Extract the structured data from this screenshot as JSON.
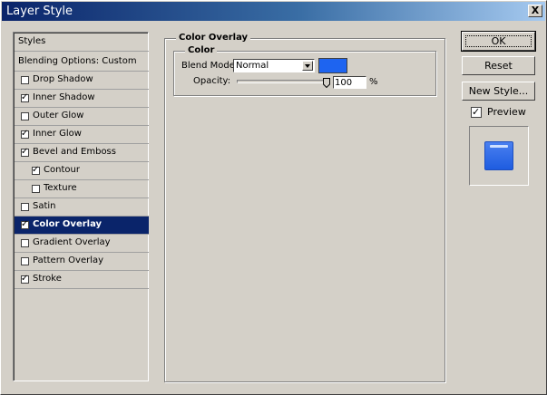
{
  "window": {
    "title": "Layer Style",
    "close_label": "X"
  },
  "styles_list": {
    "header": "Styles",
    "blending": "Blending Options: Custom",
    "items": [
      {
        "label": "Drop Shadow",
        "checked": false
      },
      {
        "label": "Inner Shadow",
        "checked": true
      },
      {
        "label": "Outer Glow",
        "checked": false
      },
      {
        "label": "Inner Glow",
        "checked": true
      },
      {
        "label": "Bevel and Emboss",
        "checked": true
      },
      {
        "label": "Contour",
        "checked": true
      },
      {
        "label": "Texture",
        "checked": false
      },
      {
        "label": "Satin",
        "checked": false
      },
      {
        "label": "Color Overlay",
        "checked": true,
        "selected": true
      },
      {
        "label": "Gradient Overlay",
        "checked": false
      },
      {
        "label": "Pattern Overlay",
        "checked": false
      },
      {
        "label": "Stroke",
        "checked": true
      }
    ]
  },
  "color_overlay": {
    "group_title": "Color Overlay",
    "color_group_title": "Color",
    "blend_mode_label": "Blend Mode:",
    "blend_mode_value": "Normal",
    "overlay_color": "#1e64f0",
    "opacity_label": "Opacity:",
    "opacity_value": "100",
    "opacity_unit": "%"
  },
  "buttons": {
    "ok": "OK",
    "reset": "Reset",
    "new_style": "New Style..."
  },
  "preview": {
    "label": "Preview",
    "checked": true
  },
  "check_mark": "✓"
}
